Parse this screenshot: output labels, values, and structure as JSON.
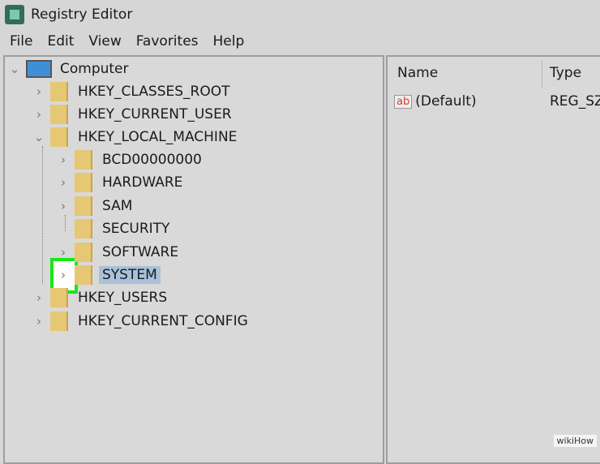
{
  "window": {
    "title": "Registry Editor"
  },
  "menu": [
    "File",
    "Edit",
    "View",
    "Favorites",
    "Help"
  ],
  "tree": {
    "root": "Computer",
    "hives": [
      "HKEY_CLASSES_ROOT",
      "HKEY_CURRENT_USER",
      "HKEY_LOCAL_MACHINE"
    ],
    "hklm_children": [
      "BCD00000000",
      "HARDWARE",
      "SAM",
      "SECURITY",
      "SOFTWARE",
      "SYSTEM"
    ],
    "more_hives": [
      "HKEY_USERS",
      "HKEY_CURRENT_CONFIG"
    ],
    "selected": "SYSTEM"
  },
  "list": {
    "columns": [
      "Name",
      "Type"
    ],
    "rows": [
      {
        "name": "(Default)",
        "type": "REG_SZ",
        "icon": "ab-string-icon"
      }
    ]
  },
  "highlight_color": "#19e619",
  "watermark": "wikiHow"
}
